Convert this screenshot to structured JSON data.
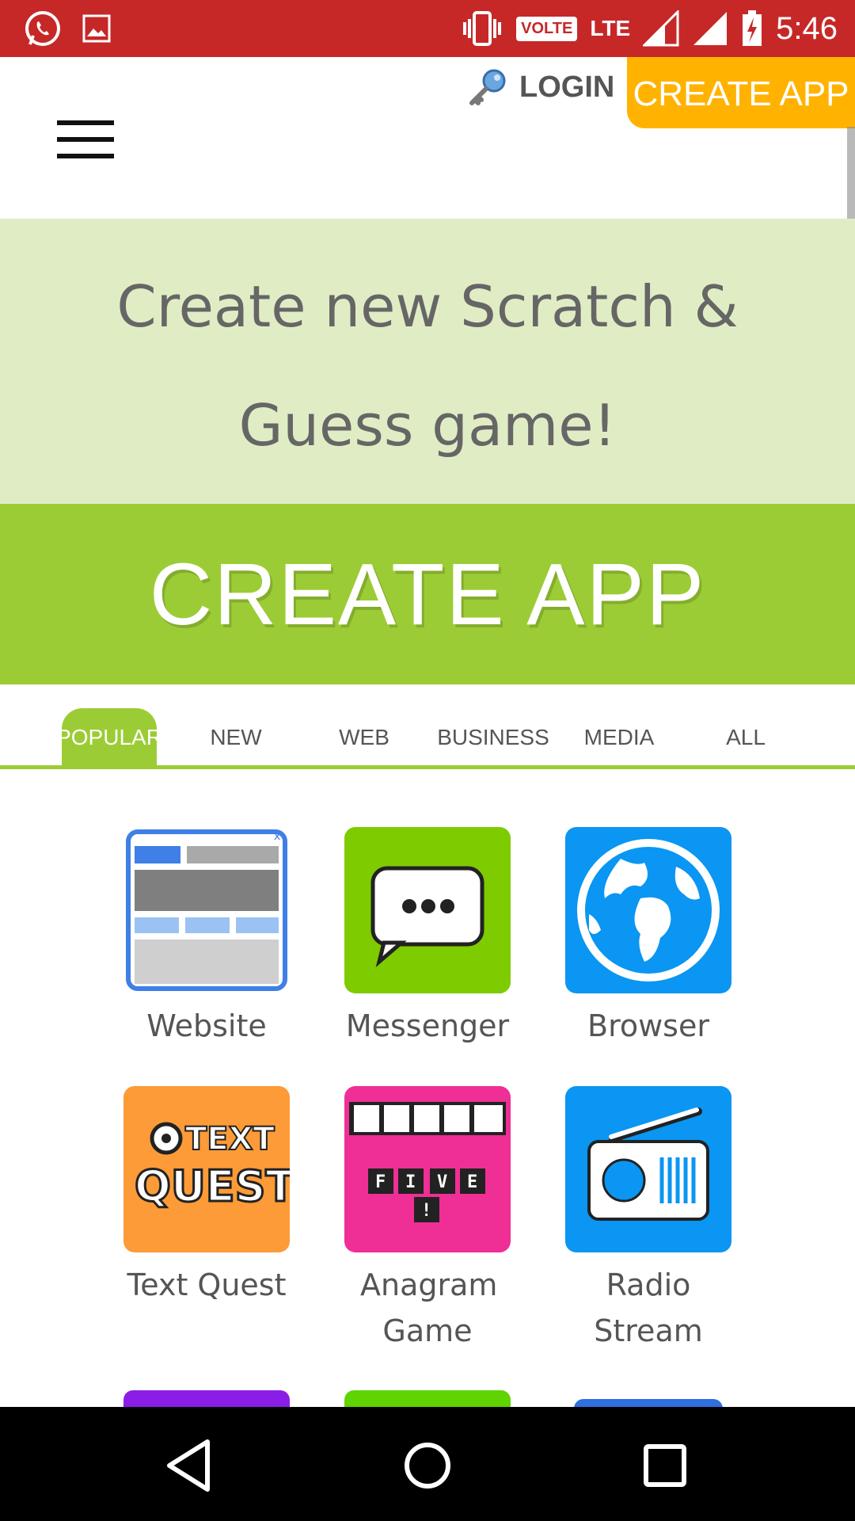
{
  "status_bar": {
    "time": "5:46",
    "volte": "VOLTE",
    "lte": "LTE",
    "icons": [
      "whatsapp-icon",
      "gallery-icon",
      "vibrate-icon",
      "signal-icon",
      "battery-charging-icon"
    ]
  },
  "header": {
    "menu_icon": "hamburger-icon",
    "login_label": "LOGIN",
    "login_icon": "key-icon",
    "create_button": "CREATE APP"
  },
  "hero": {
    "title": "Create new Scratch & Guess game!",
    "cta_label": "CREATE APP"
  },
  "tabs": [
    {
      "label": "POPULAR",
      "active": true
    },
    {
      "label": "NEW",
      "active": false
    },
    {
      "label": "WEB",
      "active": false
    },
    {
      "label": "BUSINESS",
      "active": false
    },
    {
      "label": "MEDIA",
      "active": false
    },
    {
      "label": "ALL",
      "active": false
    }
  ],
  "apps": [
    {
      "label": "Website",
      "icon": "website-icon"
    },
    {
      "label": "Messenger",
      "icon": "messenger-icon"
    },
    {
      "label": "Browser",
      "icon": "globe-icon"
    },
    {
      "label": "Text Quest",
      "icon": "text-quest-icon",
      "icon_text": [
        "TEXT",
        "QUEST"
      ]
    },
    {
      "label": "Anagram Game",
      "icon": "anagram-icon",
      "icon_text": [
        "F",
        "I",
        "V",
        "E",
        "!"
      ]
    },
    {
      "label": "Radio Stream",
      "icon": "radio-icon"
    }
  ],
  "colors": {
    "status_bar": "#c62828",
    "accent_green": "#9ccc35",
    "hero_bg": "#e0edc4",
    "create_orange": "#ffb300"
  }
}
